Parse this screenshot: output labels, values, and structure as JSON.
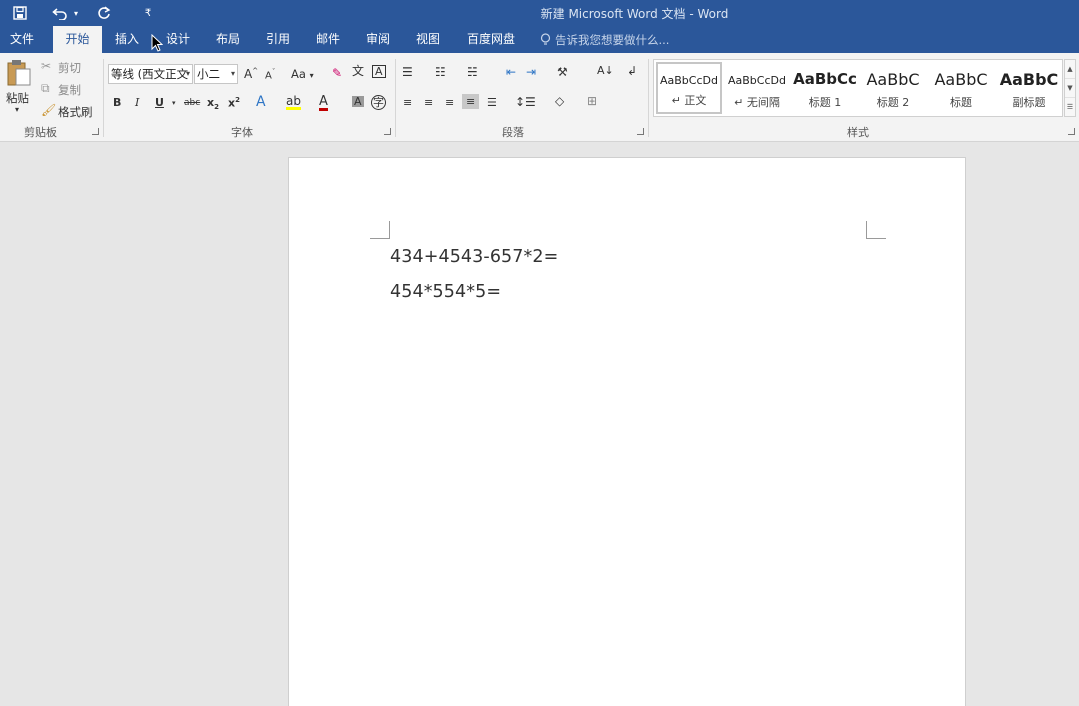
{
  "window": {
    "title": "新建 Microsoft Word 文档 - Word"
  },
  "qat": {
    "customize_glyph": "₹"
  },
  "tabs": [
    {
      "label": "文件"
    },
    {
      "label": "开始"
    },
    {
      "label": "插入"
    },
    {
      "label": "设计"
    },
    {
      "label": "布局"
    },
    {
      "label": "引用"
    },
    {
      "label": "邮件"
    },
    {
      "label": "审阅"
    },
    {
      "label": "视图"
    },
    {
      "label": "百度网盘"
    }
  ],
  "tell_me": {
    "placeholder": "告诉我您想要做什么..."
  },
  "clipboard": {
    "paste_label": "粘贴",
    "cut_label": "剪切",
    "copy_label": "复制",
    "format_painter_label": "格式刷",
    "group_label": "剪贴板"
  },
  "font": {
    "font_name": "等线 (西文正文",
    "font_size": "小二",
    "change_case_label": "Aa",
    "group_label": "字体"
  },
  "paragraph": {
    "group_label": "段落"
  },
  "styles": {
    "group_label": "样式",
    "items": [
      {
        "sample": "AaBbCcDd",
        "name": "↵ 正文"
      },
      {
        "sample": "AaBbCcDd",
        "name": "↵ 无间隔"
      },
      {
        "sample": "AaBbCc",
        "name": "标题 1"
      },
      {
        "sample": "AaBbC",
        "name": "标题 2"
      },
      {
        "sample": "AaBbC",
        "name": "标题"
      },
      {
        "sample": "AaBbC",
        "name": "副标题"
      }
    ]
  },
  "document": {
    "lines": [
      "434+4543-657*2=",
      "454*554*5="
    ]
  },
  "colors": {
    "title_bar": "#2b579a",
    "ribbon": "#f3f3f3",
    "canvas": "#e6e6e6"
  }
}
